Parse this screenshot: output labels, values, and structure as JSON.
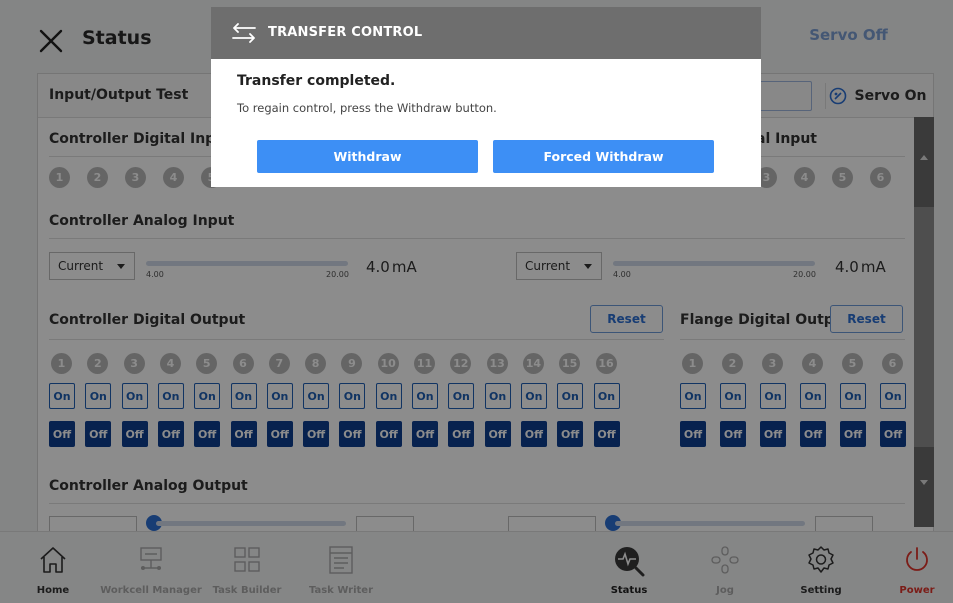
{
  "header": {
    "title": "Status",
    "servo_off": "Servo Off"
  },
  "card": {
    "title": "Input/Output Test",
    "servo_on": "Servo On"
  },
  "sections": {
    "controller_digital_input": "Controller Digital Input",
    "flange_digital_input_partial": "al Input",
    "controller_analog_input": "Controller Analog Input",
    "controller_digital_output": "Controller Digital Output",
    "flange_digital_output": "Flange Digital Output",
    "controller_analog_output": "Controller Analog Output"
  },
  "digital_input": {
    "left_numbers": [
      "1",
      "2",
      "3",
      "4",
      "5"
    ],
    "right_numbers": [
      "3",
      "4",
      "5",
      "6"
    ]
  },
  "analog_input": {
    "left": {
      "mode": "Current",
      "min_tick": "4.00",
      "max_tick": "20.00",
      "value": "4.0",
      "unit": "mA"
    },
    "right": {
      "mode": "Current",
      "min_tick": "4.00",
      "max_tick": "20.00",
      "value": "4.0",
      "unit": "mA"
    }
  },
  "digital_output": {
    "reset_label": "Reset",
    "controller_numbers": [
      "1",
      "2",
      "3",
      "4",
      "5",
      "6",
      "7",
      "8",
      "9",
      "10",
      "11",
      "12",
      "13",
      "14",
      "15",
      "16"
    ],
    "flange_numbers": [
      "1",
      "2",
      "3",
      "4",
      "5",
      "6"
    ],
    "on_label": "On",
    "off_label": "Off"
  },
  "nav": [
    {
      "label": "Home",
      "icon": "home-icon",
      "active": true
    },
    {
      "label": "Workcell Manager",
      "icon": "workcell-icon",
      "active": false
    },
    {
      "label": "Task Builder",
      "icon": "task-builder-icon",
      "active": false
    },
    {
      "label": "Task Writer",
      "icon": "task-writer-icon",
      "active": false
    },
    {
      "label": "Status",
      "icon": "status-icon",
      "active": true
    },
    {
      "label": "Jog",
      "icon": "jog-icon",
      "active": false
    },
    {
      "label": "Setting",
      "icon": "gear-icon",
      "active": true
    },
    {
      "label": "Power",
      "icon": "power-icon",
      "active": true
    }
  ],
  "dialog": {
    "title": "TRANSFER CONTROL",
    "message": "Transfer completed.",
    "sub_message": "To regain control, press the Withdraw button.",
    "withdraw": "Withdraw",
    "forced_withdraw": "Forced Withdraw"
  },
  "colors": {
    "accent": "#3d8ff5",
    "off_button": "#0d3f91",
    "power": "#e0342b"
  }
}
